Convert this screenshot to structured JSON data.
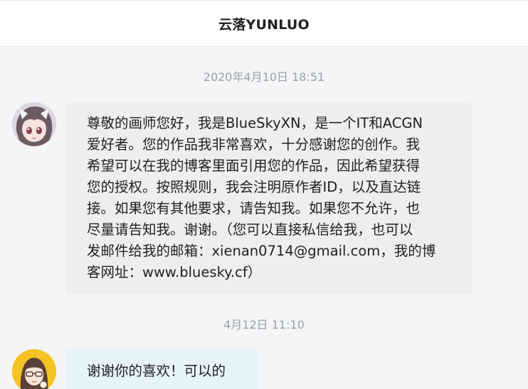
{
  "header": {
    "title": "云落YUNLUO"
  },
  "messages": [
    {
      "timestamp": "2020年4月10日 18:51",
      "lines": [
        "尊敬的画师您好，我是BlueSkyXN，是一个IT和ACGN",
        "爱好者。您的作品我非常喜欢，十分感谢您的创作。我",
        "希望可以在我的博客里面引用您的作品，因此希望获得",
        "您的授权。按照规则，我会注明原作者ID，以及直达链",
        "接。如果您有其他要求，请告知我。如果您不允许，也",
        "尽量请告知我。谢谢。（您可以直接私信给我，也可以",
        "发邮件给我的邮箱：xienan0714@gmail.com，我的博",
        "客网址：www.bluesky.cf）"
      ]
    },
    {
      "timestamp": "4月12日 11:10",
      "text": "谢谢你的喜欢！可以的"
    }
  ],
  "colors": {
    "background": "#f4f5f7",
    "header_bg": "#ffffff",
    "sent_bubble": "#eeeeef",
    "received_bubble": "#e6f3fb",
    "timestamp": "#9aa0a8"
  }
}
